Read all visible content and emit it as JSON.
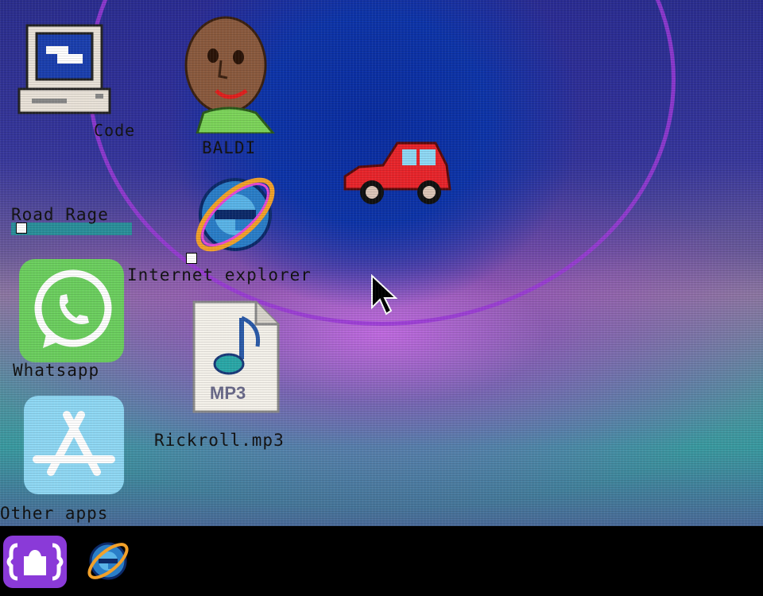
{
  "desktop": {
    "icons": {
      "computer": {
        "label": "Code",
        "icon": "computer-icon"
      },
      "baldi": {
        "label": "BALDI",
        "icon": "baldi-head-icon"
      },
      "road_rage": {
        "label": "Road Rage",
        "icon": "shortcut-icon"
      },
      "car": {
        "icon": "red-car-icon"
      },
      "browser": {
        "label": "Internet explorer",
        "icon": "internet-explorer-icon"
      },
      "whatsapp": {
        "label": "Whatsapp",
        "icon": "whatsapp-icon"
      },
      "mp3": {
        "label": "Rickroll.mp3",
        "badge": "MP3",
        "icon": "mp3-file-icon"
      },
      "other_apps": {
        "label": "Other apps",
        "icon": "app-store-icon"
      }
    }
  },
  "taskbar": {
    "items": [
      {
        "icon": "puzzle-icon"
      },
      {
        "icon": "internet-explorer-icon"
      }
    ]
  },
  "colors": {
    "taskbar": "#000000",
    "sky": "#0d34a8",
    "arc": "#9b3ad8",
    "whatsapp": "#6ccf5f",
    "app_store": "#8fd8f4",
    "car": "#e8252b",
    "puzzle": "#8a3ad8"
  }
}
